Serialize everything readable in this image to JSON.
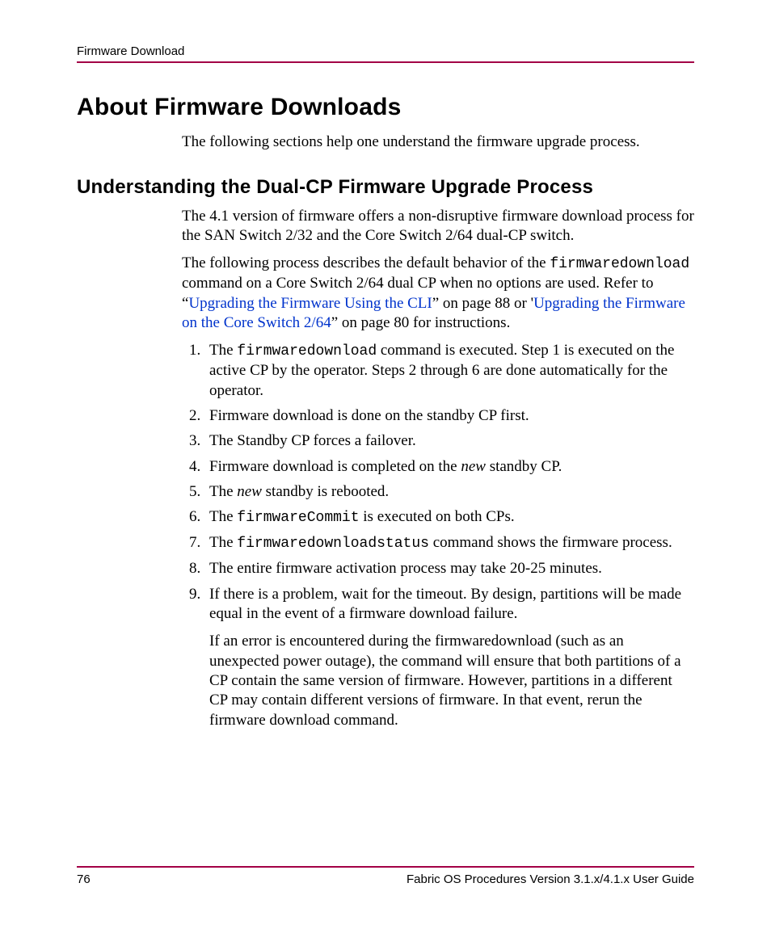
{
  "header": {
    "running_title": "Firmware Download"
  },
  "h1": "About Firmware Downloads",
  "intro": "The following sections help one understand the firmware upgrade process.",
  "h2": "Understanding the Dual-CP Firmware Upgrade Process",
  "p1": "The 4.1 version of firmware offers a non-disruptive firmware download process for the SAN Switch 2/32 and the Core Switch 2/64 dual-CP switch.",
  "p2": {
    "t1": "The following process describes the default behavior of the ",
    "code1": "firmwaredownload",
    "t2": " command on a Core Switch 2/64 dual CP when no options are used. Refer to “",
    "link1": "Upgrading the Firmware Using the CLI",
    "t3": "” on page 88 or '",
    "link2": "Upgrading the Firmware on the Core Switch 2/64",
    "t4": "” on page 80 for instructions."
  },
  "steps": {
    "s1": {
      "a": "The ",
      "code": "firmwaredownload",
      "b": " command is executed. Step 1 is executed on the active CP by the operator. Steps 2 through 6 are done automatically for the operator."
    },
    "s2": "Firmware download is done on the standby CP first.",
    "s3": "The Standby CP forces a failover.",
    "s4": {
      "a": "Firmware download is completed on the ",
      "em": "new",
      "b": " standby CP."
    },
    "s5": {
      "a": "The ",
      "em": "new",
      "b": " standby is rebooted."
    },
    "s6": {
      "a": "The ",
      "code": "firmwareCommit",
      "b": " is executed on both CPs."
    },
    "s7": {
      "a": "The ",
      "code": "firmwaredownloadstatus",
      "b": " command shows the firmware process."
    },
    "s8": "The entire firmware activation process may take 20-25 minutes.",
    "s9": "If there is a problem, wait for the timeout. By design, partitions will be made equal in the event of a firmware download failure."
  },
  "after": "If an error is encountered during the firmwaredownload (such as an unexpected power outage), the command will ensure that both partitions of a CP contain the same version of firmware. However, partitions in a different CP may contain different versions of firmware. In that event, rerun the firmware download command.",
  "footer": {
    "page": "76",
    "title": "Fabric OS Procedures Version 3.1.x/4.1.x User Guide"
  }
}
